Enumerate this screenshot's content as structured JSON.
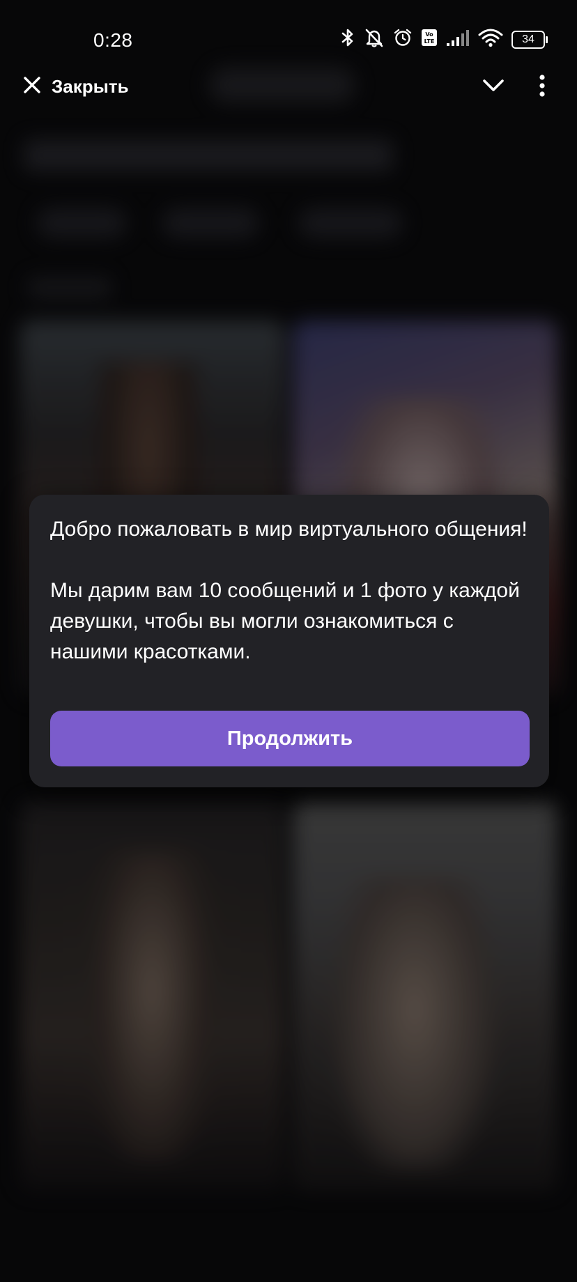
{
  "status_bar": {
    "time": "0:28",
    "battery_level": "34",
    "icons": [
      "bluetooth-icon",
      "notifications-off-icon",
      "alarm-icon",
      "volte-icon",
      "cellular-signal-icon",
      "wifi-icon",
      "battery-icon"
    ]
  },
  "nav": {
    "close_label": "Закрыть",
    "close_icon": "close-icon",
    "chevron_icon": "chevron-down-icon",
    "more_icon": "more-vertical-icon"
  },
  "modal": {
    "paragraph_1": "Добро пожаловать в мир виртуального общения!",
    "paragraph_2": "Мы дарим вам 10 сообщений и 1 фото у каждой девушки, чтобы вы могли ознакомиться с нашими красотками.",
    "continue_label": "Продолжить"
  },
  "colors": {
    "background": "#0b0b0d",
    "modal_bg": "#222226",
    "accent": "#7b5ccc",
    "text": "#ffffff"
  }
}
